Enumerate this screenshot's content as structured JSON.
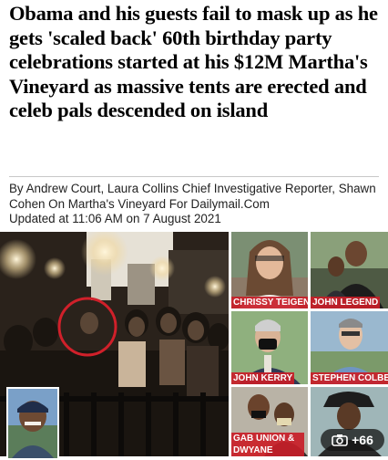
{
  "article": {
    "headline": "Obama and his guests fail to mask up as he gets 'scaled back' 60th birthday party celebrations started at his $12M Martha's Vineyard as massive tents are erected and celeb pals descended on island",
    "byline": "By Andrew Court, Laura Collins Chief Investigative Reporter, Shawn Cohen On Martha's Vineyard For Dailymail.Com",
    "updated": "Updated at 11:06 AM on 7 August 2021"
  },
  "gallery": {
    "captions": [
      "CHRISSY TEIGEN",
      "JOHN LEGEND",
      "JOHN KERRY",
      "STEPHEN COLBERT",
      "GAB UNION &",
      "DWYANE WADE"
    ],
    "photo_count": "+66",
    "counter_icon": "camera-icon"
  },
  "colors": {
    "caption_bg": "#c81e28",
    "caption_text": "#ffffff",
    "highlight_circle": "#d0202a"
  }
}
